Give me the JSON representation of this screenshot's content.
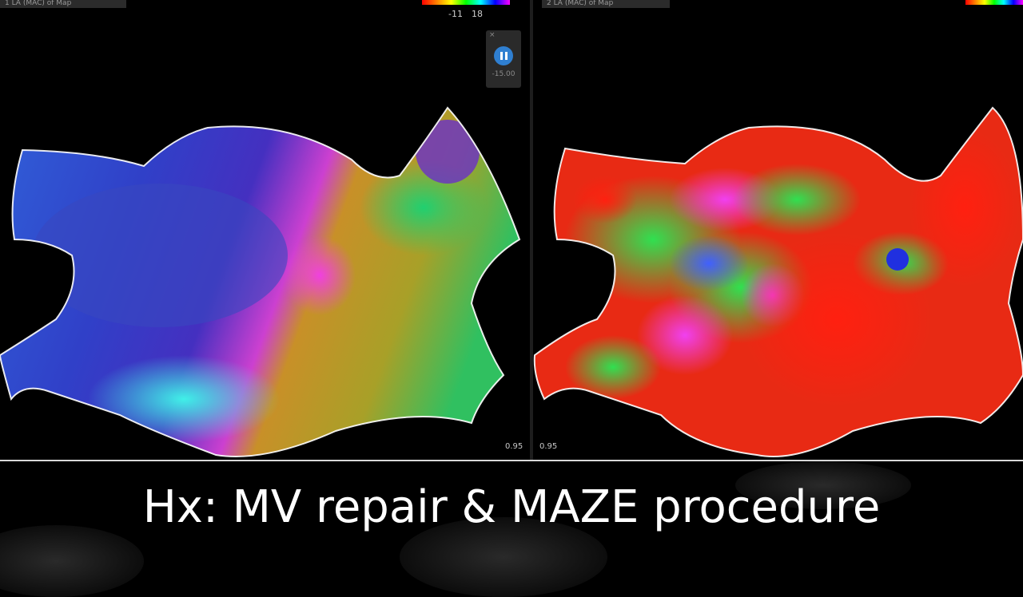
{
  "left_view": {
    "window_title": "1 LA (MAC) of Map",
    "colorbar_min": "-11",
    "colorbar_max": "18",
    "opacity_value": "0.95",
    "playback": {
      "close_label": "×",
      "time": "-15.00",
      "pause_icon": "pause-icon"
    }
  },
  "right_view": {
    "window_title": "2 LA (MAC) of Map",
    "opacity_value": "0.95"
  },
  "caption": "Hx: MV repair & MAZE procedure",
  "colors": {
    "background": "#000000",
    "caption_text": "#ffffff",
    "pause_button": "#2f7fd1"
  }
}
